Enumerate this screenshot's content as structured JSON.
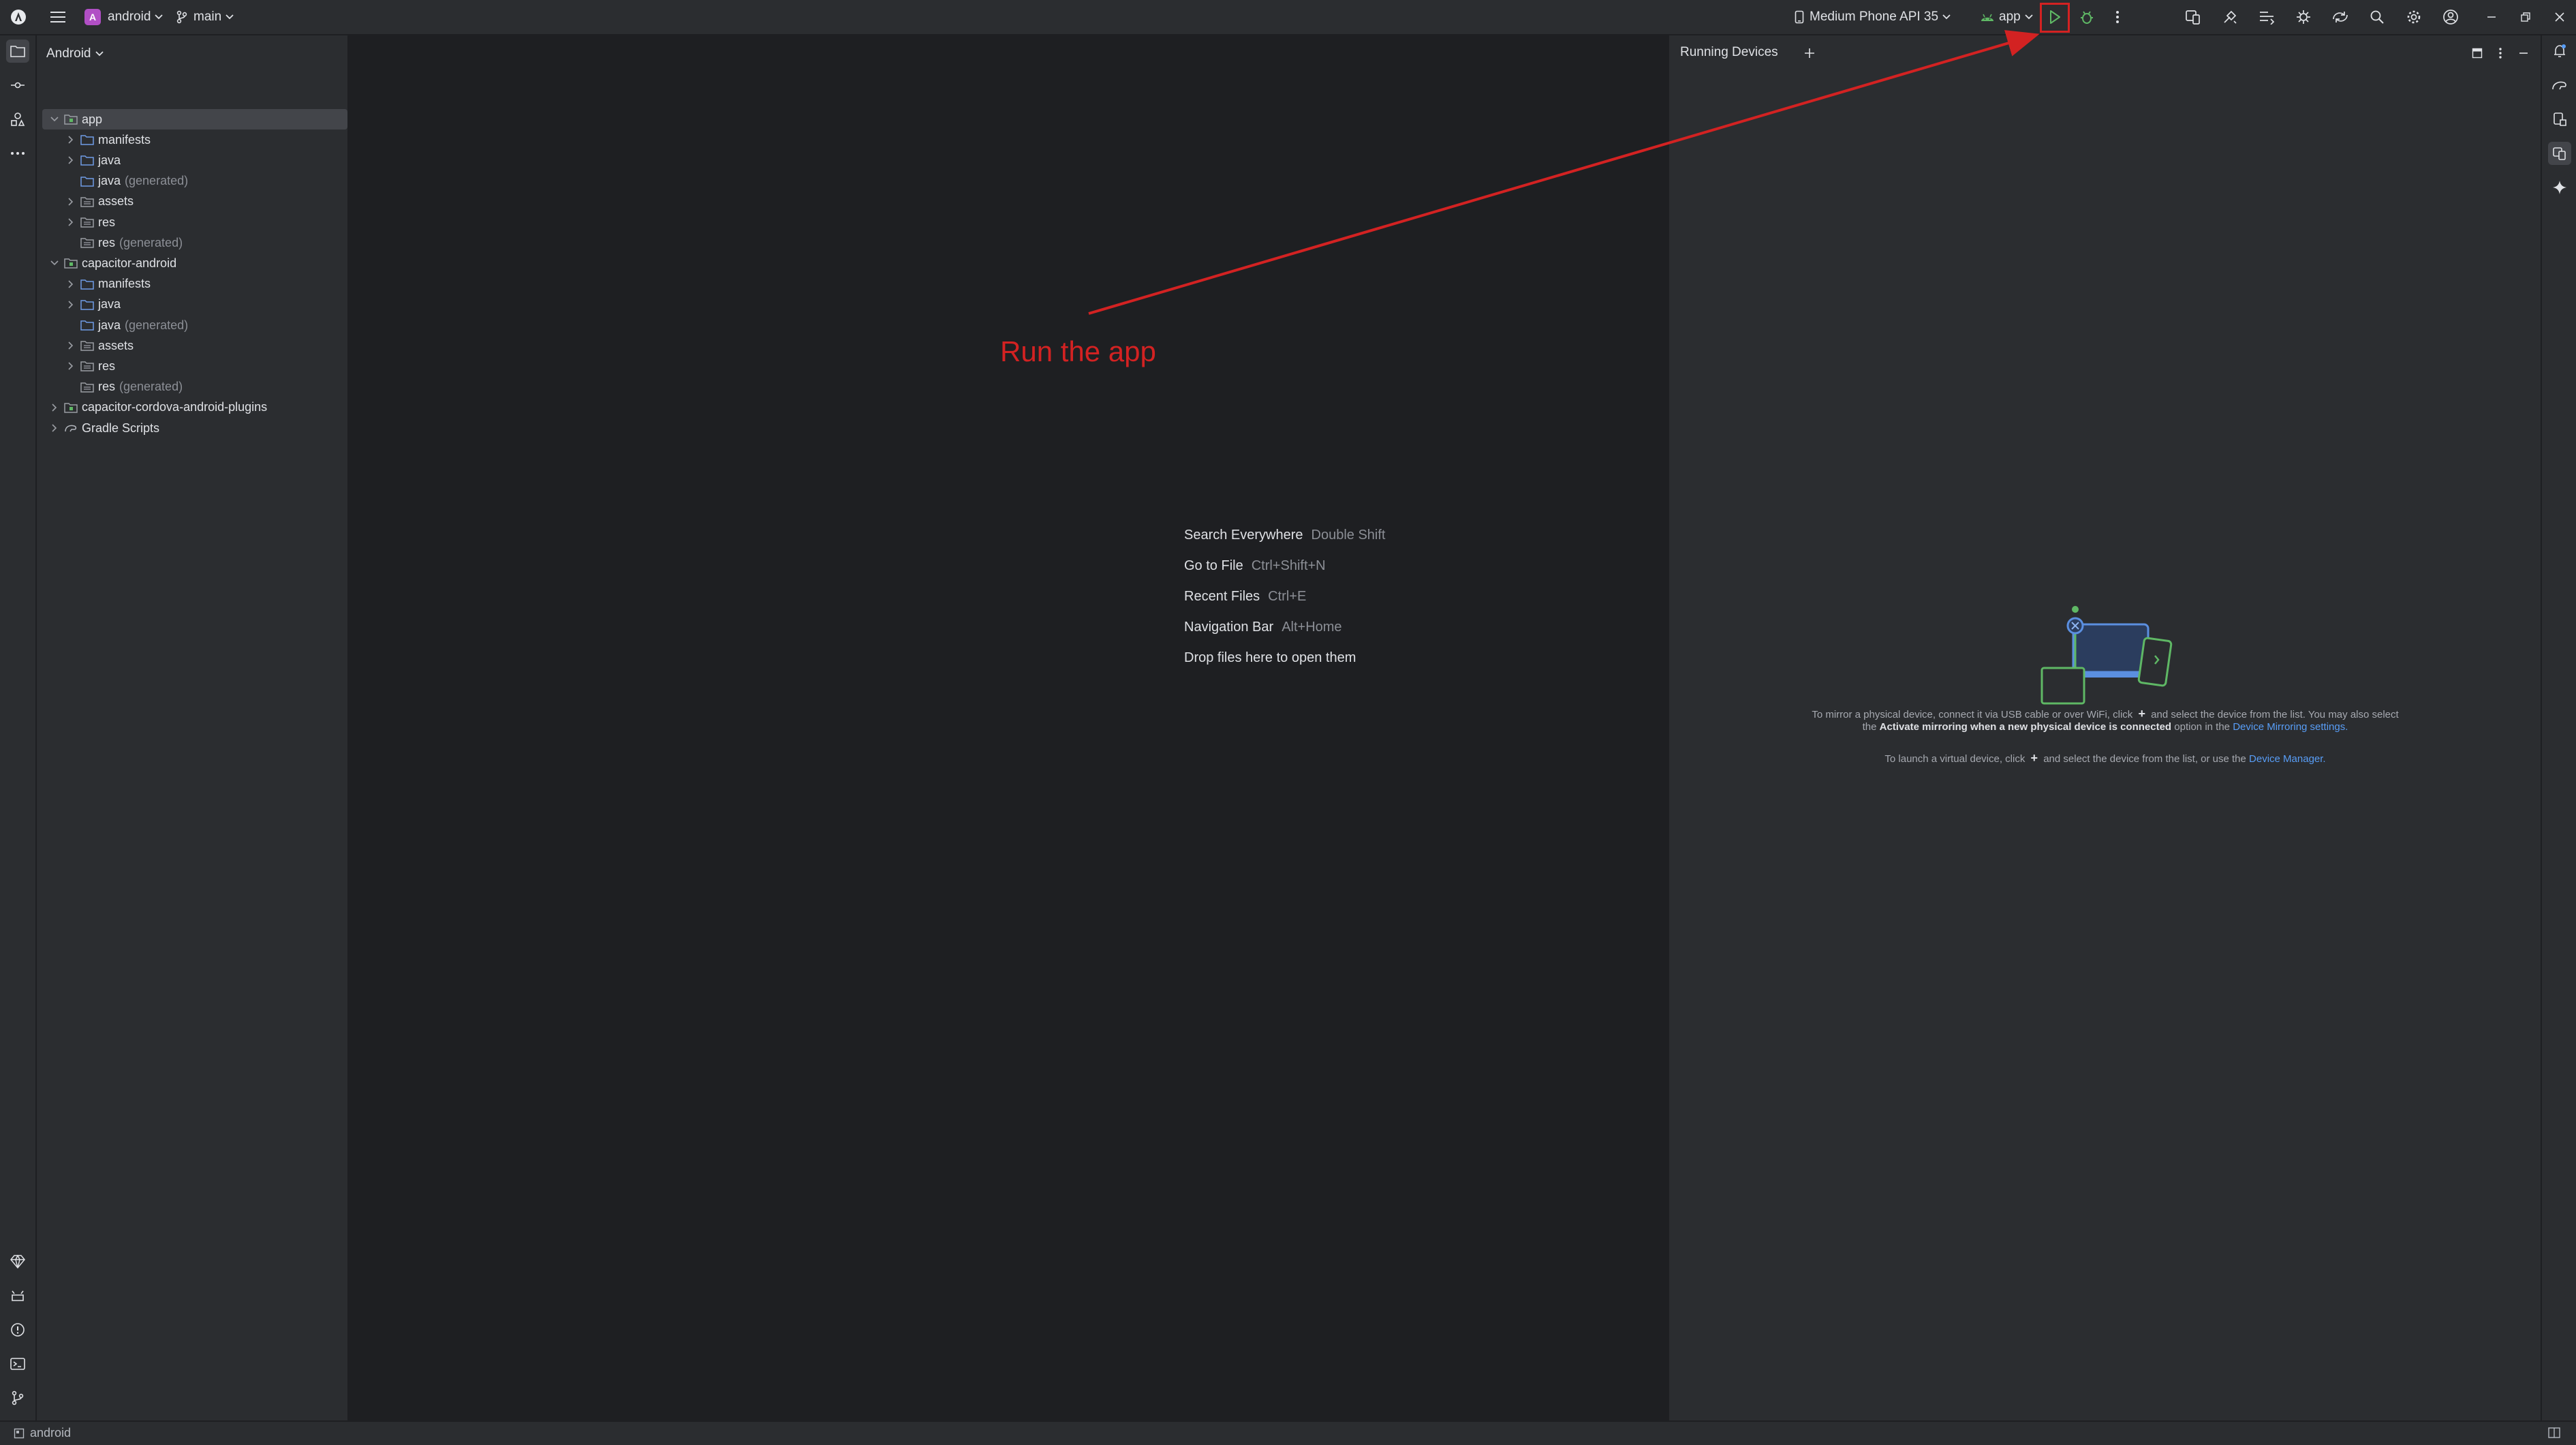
{
  "titlebar": {
    "project_badge": "A",
    "project_name": "android",
    "branch": "main",
    "device": "Medium Phone API 35",
    "run_config": "app"
  },
  "project_panel": {
    "view_mode": "Android",
    "tree": [
      {
        "label": "app",
        "generated": "",
        "level": 0,
        "expanded": true,
        "selected": true,
        "module": true
      },
      {
        "label": "manifests",
        "generated": "",
        "level": 1,
        "expanded": false
      },
      {
        "label": "java",
        "generated": "",
        "level": 1,
        "expanded": false
      },
      {
        "label": "java",
        "generated": "(generated)",
        "level": 1,
        "leaf": true
      },
      {
        "label": "assets",
        "generated": "",
        "level": 1,
        "expanded": false
      },
      {
        "label": "res",
        "generated": "",
        "level": 1,
        "expanded": false
      },
      {
        "label": "res",
        "generated": "(generated)",
        "level": 1,
        "leaf": true
      },
      {
        "label": "capacitor-android",
        "generated": "",
        "level": 0,
        "expanded": true,
        "module": true
      },
      {
        "label": "manifests",
        "generated": "",
        "level": 1,
        "expanded": false
      },
      {
        "label": "java",
        "generated": "",
        "level": 1,
        "expanded": false
      },
      {
        "label": "java",
        "generated": "(generated)",
        "level": 1,
        "leaf": true
      },
      {
        "label": "assets",
        "generated": "",
        "level": 1,
        "expanded": false
      },
      {
        "label": "res",
        "generated": "",
        "level": 1,
        "expanded": false
      },
      {
        "label": "res",
        "generated": "(generated)",
        "level": 1,
        "leaf": true
      },
      {
        "label": "capacitor-cordova-android-plugins",
        "generated": "",
        "level": 0,
        "expanded": false,
        "module": true
      },
      {
        "label": "Gradle Scripts",
        "generated": "",
        "level": 0,
        "expanded": false,
        "gradle": true
      }
    ]
  },
  "editor_hints": [
    {
      "action": "Search Everywhere",
      "shortcut": "Double Shift"
    },
    {
      "action": "Go to File",
      "shortcut": "Ctrl+Shift+N"
    },
    {
      "action": "Recent Files",
      "shortcut": "Ctrl+E"
    },
    {
      "action": "Navigation Bar",
      "shortcut": "Alt+Home"
    },
    {
      "action": "Drop files here to open them",
      "shortcut": ""
    }
  ],
  "running_devices": {
    "title": "Running Devices",
    "line1_a": "To mirror a physical device, connect it via USB cable or over WiFi, click",
    "line1_b": "and select the device from the list. You may also select",
    "line2_a": "the",
    "line2_strong": "Activate mirroring when a new physical device is connected",
    "line2_b": "option in the",
    "line2_link": "Device Mirroring settings.",
    "line3_a": "To launch a virtual device, click",
    "line3_b": "and select the device from the list, or use the",
    "line3_link": "Device Manager."
  },
  "annotation": {
    "text": "Run the app",
    "color": "#d32222"
  },
  "statusbar": {
    "project": "android"
  },
  "colors": {
    "background": "#1e1f22",
    "panel": "#2b2d30",
    "selection": "#43454a",
    "accent_green": "#5fb865",
    "link": "#589df6",
    "folder_blue": "#6f9ce6"
  }
}
